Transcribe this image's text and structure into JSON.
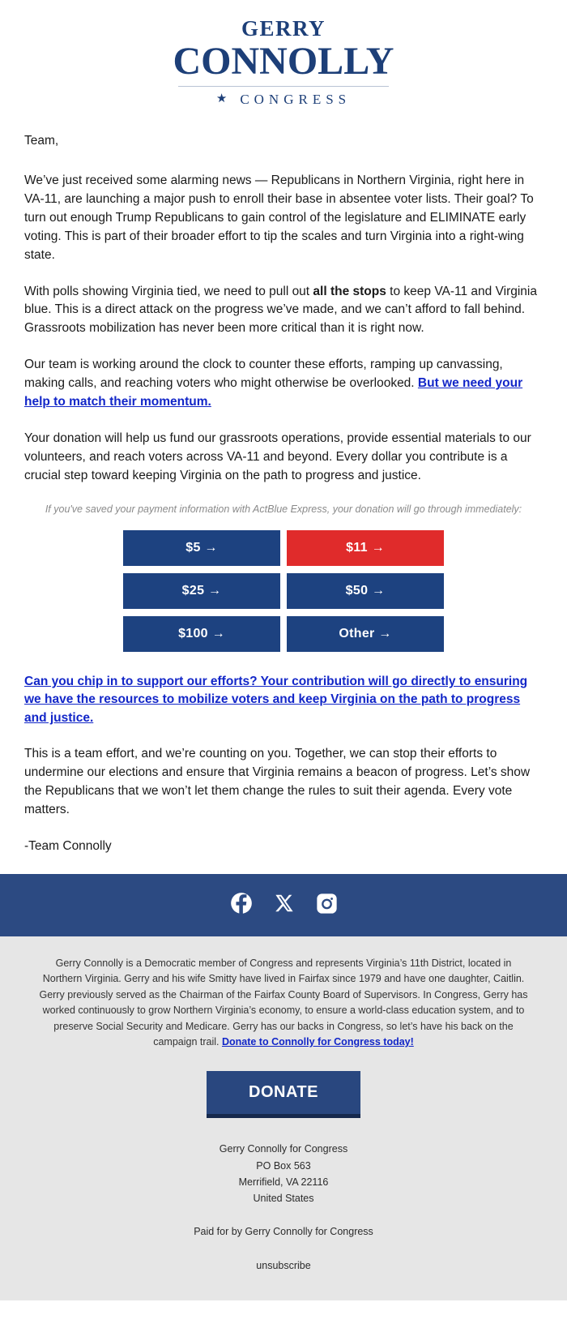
{
  "logo": {
    "first_name": "GERRY",
    "last_name": "CONNOLLY",
    "subtitle": "CONGRESS",
    "star": "★",
    "color": "#1d3f78"
  },
  "email": {
    "greeting": "Team,",
    "paragraph_1": "We’ve just received some alarming news — Republicans in Northern Virginia, right here in VA-11, are launching a major push to enroll their base in absentee voter lists. Their goal? To turn out enough Trump Republicans to gain control of the legislature and ELIMINATE early voting. This is part of their broader effort to tip the scales and turn Virginia into a right-wing state.",
    "paragraph_2_part_1": "With polls showing Virginia tied, we need to pull out ",
    "paragraph_2_bold": "all the stops",
    "paragraph_2_part_2": " to keep VA-11 and Virginia blue. This is a direct attack on the progress we’ve made, and we can’t afford to fall behind. Grassroots mobilization has never been more critical than it is right now.",
    "paragraph_3_part_1": "Our team is working around the clock to counter these efforts, ramping up canvassing, making calls, and reaching voters who might otherwise be overlooked. ",
    "paragraph_3_link": "But we need your help to match their momentum.",
    "paragraph_4": "Your donation will help us fund our grassroots operations, provide essential materials to our volunteers, and reach voters across VA-11 and beyond. Every dollar you contribute is a crucial step toward keeping Virginia on the path to progress and justice.",
    "actblue_disclaimer": "If you've saved your payment information with ActBlue Express, your donation will go through immediately:",
    "cta_link": "Can you chip in to support our efforts? Your contribution will go directly to ensuring we have the resources to mobilize voters and keep Virginia on the path to progress and justice.",
    "paragraph_5": "This is a team effort, and we’re counting on you. Together, we can stop their efforts to undermine our elections and ensure that Virginia remains a beacon of progress. Let’s show the Republicans that we won’t let them change the rules to suit their agenda. Every vote matters.",
    "signoff": "-Team Connolly"
  },
  "donation": {
    "buttons": [
      {
        "label": "$5 →",
        "amount": "5",
        "highlighted": false
      },
      {
        "label": "$11 →",
        "amount": "11",
        "highlighted": true
      },
      {
        "label": "$25 →",
        "amount": "25",
        "highlighted": false
      },
      {
        "label": "$50 →",
        "amount": "50",
        "highlighted": false
      },
      {
        "label": "$100 →",
        "amount": "100",
        "highlighted": false
      },
      {
        "label": "Other →",
        "amount": "other",
        "highlighted": false
      }
    ],
    "default_color": "#1d4280",
    "highlight_color": "#e02b2b"
  },
  "social": {
    "bar_color": "#2c4a82",
    "items": [
      {
        "name": "facebook",
        "label": "Facebook"
      },
      {
        "name": "x-twitter",
        "label": "X"
      },
      {
        "name": "instagram",
        "label": "Instagram"
      }
    ]
  },
  "footer": {
    "bio_part_1": "Gerry Connolly is a Democratic member of Congress and represents Virginia’s 11th District, located in Northern Virginia. Gerry and his wife Smitty have lived in Fairfax since 1979 and have one daughter, Caitlin. Gerry previously served as the Chairman of the Fairfax County Board of Supervisors. In Congress, Gerry has worked continuously to grow Northern Virginia’s economy, to ensure a world-class education system, and to preserve Social Security and Medicare. Gerry has our backs in Congress, so let’s have his back on the campaign trail. ",
    "bio_link": "Donate to Connolly for Congress today!",
    "donate_button": "DONATE",
    "address_line_1": "Gerry Connolly for Congress",
    "address_line_2": "PO Box 563",
    "address_line_3": "Merrifield, VA 22116",
    "address_line_4": "United States",
    "paid_for": "Paid for by Gerry Connolly for Congress",
    "unsubscribe": "unsubscribe"
  }
}
